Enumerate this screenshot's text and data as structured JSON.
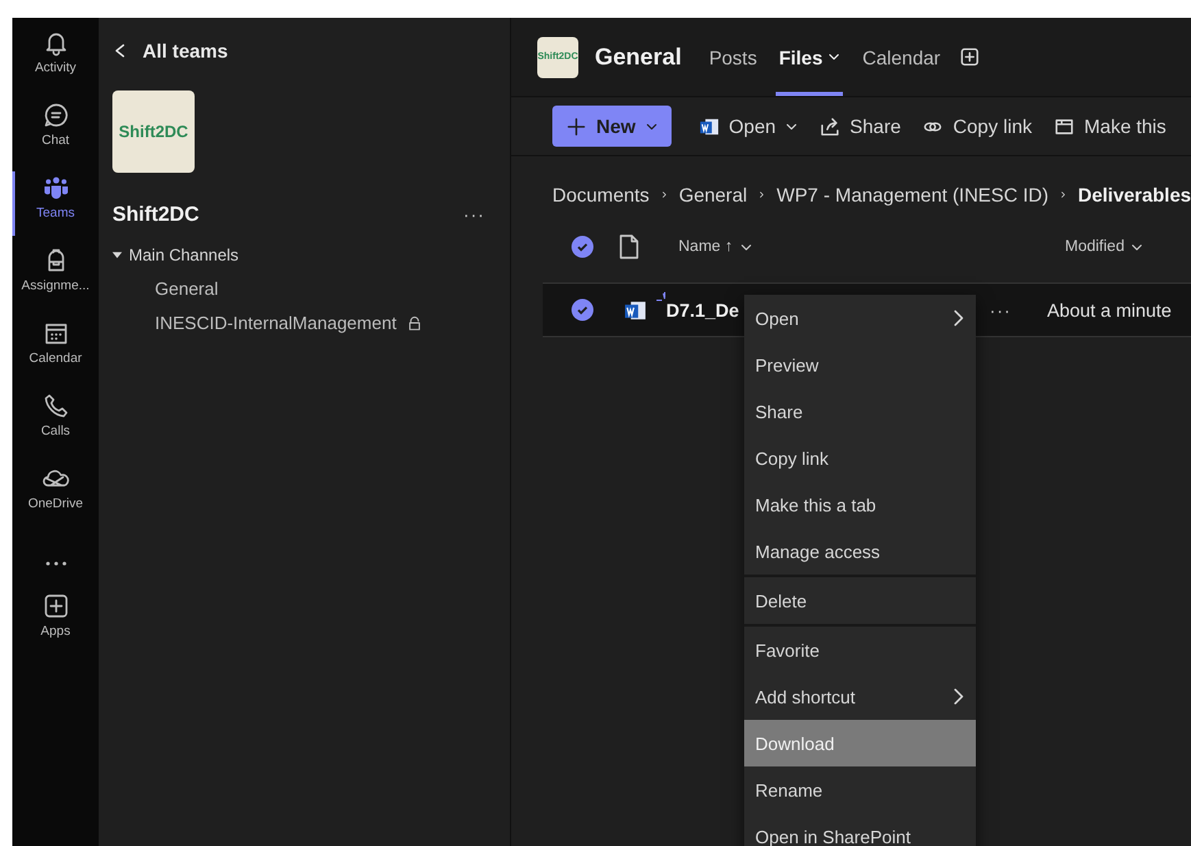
{
  "rail": [
    {
      "label": "Activity",
      "selected": false
    },
    {
      "label": "Chat",
      "selected": false
    },
    {
      "label": "Teams",
      "selected": true
    },
    {
      "label": "Assignme...",
      "selected": false
    },
    {
      "label": "Calendar",
      "selected": false
    },
    {
      "label": "Calls",
      "selected": false
    },
    {
      "label": "OneDrive",
      "selected": false
    },
    {
      "selected": false
    },
    {
      "label": "Apps",
      "selected": false
    }
  ],
  "team_panel": {
    "back": "All teams",
    "logo": "Shift2DC",
    "team_name": "Shift2DC",
    "more": "···",
    "section": {
      "label": "Main Channels",
      "expanded": true,
      "channels": [
        {
          "name": "General",
          "private": false
        },
        {
          "name": "INESCID-InternalManagement",
          "private": true
        }
      ]
    }
  },
  "channel_header": {
    "logo": "Shift2DC",
    "title": "General",
    "tabs": [
      {
        "label": "Posts",
        "selected": false,
        "dropdown": false
      },
      {
        "label": "Files",
        "selected": true,
        "dropdown": true
      },
      {
        "label": "Calendar",
        "selected": false,
        "dropdown": false
      }
    ]
  },
  "toolbar": [
    {
      "label": "New",
      "kind": "primary",
      "dropdown": true
    },
    {
      "label": "Open",
      "kind": "plain",
      "dropdown": true
    },
    {
      "label": "Share",
      "kind": "plain",
      "dropdown": false
    },
    {
      "label": "Copy link",
      "kind": "plain",
      "dropdown": false
    },
    {
      "label": "Make this",
      "kind": "plain",
      "dropdown": false
    }
  ],
  "breadcrumb": [
    {
      "label": "Documents",
      "current": false
    },
    {
      "label": "General",
      "current": false
    },
    {
      "label": "WP7 - Management (INESC ID)",
      "current": false
    },
    {
      "label": "Deliverables",
      "current": true
    }
  ],
  "table": {
    "all_selected": true,
    "columns": [
      {
        "label": "Name ↑",
        "dropdown": true
      },
      {
        "label": "Modified",
        "dropdown": true
      }
    ],
    "rows": [
      {
        "name": "D7.1_De",
        "modified": "About a minute",
        "selected": true,
        "more": "···"
      }
    ]
  },
  "context_menu": [
    [
      {
        "label": "Open",
        "submenu": true,
        "highlighted": false
      },
      {
        "label": "Preview",
        "submenu": false,
        "highlighted": false
      },
      {
        "label": "Share",
        "submenu": false,
        "highlighted": false
      },
      {
        "label": "Copy link",
        "submenu": false,
        "highlighted": false
      },
      {
        "label": "Make this a tab",
        "submenu": false,
        "highlighted": false
      },
      {
        "label": "Manage access",
        "submenu": false,
        "highlighted": false
      }
    ],
    [
      {
        "label": "Delete",
        "submenu": false,
        "highlighted": false
      }
    ],
    [
      {
        "label": "Favorite",
        "submenu": false,
        "highlighted": false
      },
      {
        "label": "Add shortcut",
        "submenu": true,
        "highlighted": false
      },
      {
        "label": "Download",
        "submenu": false,
        "highlighted": true
      },
      {
        "label": "Rename",
        "submenu": false,
        "highlighted": false
      },
      {
        "label": "Open in SharePoint",
        "submenu": false,
        "highlighted": false
      }
    ]
  ]
}
